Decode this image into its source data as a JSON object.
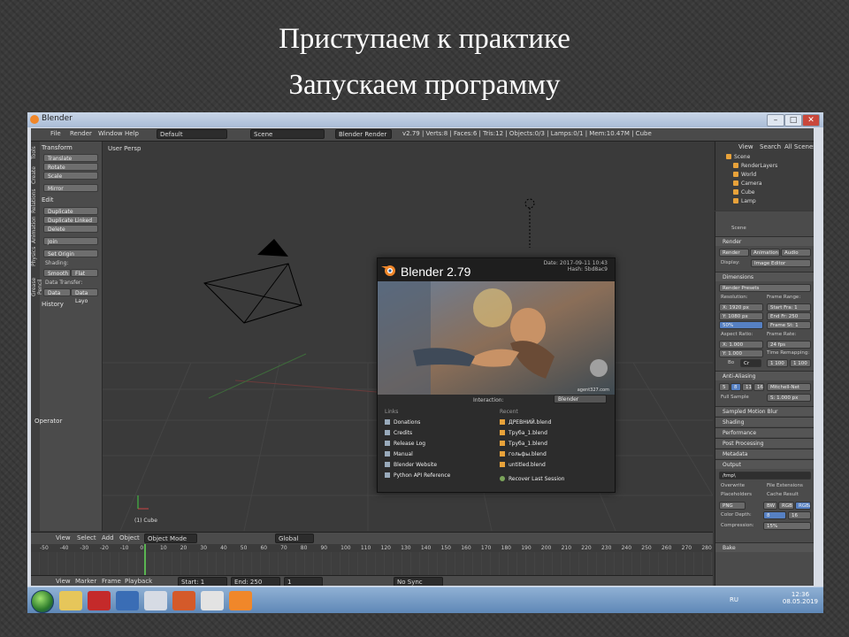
{
  "slide": {
    "title_line1": "Приступаем к практике",
    "title_line2": "Запускаем программу"
  },
  "window": {
    "title": "Blender",
    "buttons": [
      "–",
      "□",
      "✕"
    ]
  },
  "infobar": {
    "menus": [
      "File",
      "Render",
      "Window",
      "Help"
    ],
    "layout": "Default",
    "scene": "Scene",
    "engine": "Blender Render",
    "stats": "v2.79 | Verts:8 | Faces:6 | Tris:12 | Objects:0/3 | Lamps:0/1 | Mem:10.47M | Cube"
  },
  "toolshelf": {
    "tabs": [
      "Tools",
      "Create",
      "Relations",
      "Animation",
      "Physics",
      "Grease Pencil"
    ],
    "transform_header": "Transform",
    "transform_buttons": [
      "Translate",
      "Rotate",
      "Scale"
    ],
    "mirror": "Mirror",
    "edit_header": "Edit",
    "edit_buttons": [
      "Duplicate",
      "Duplicate Linked",
      "Delete"
    ],
    "join": "Join",
    "set_origin": "Set Origin",
    "shading_label": "Shading:",
    "smooth": "Smooth",
    "flat": "Flat",
    "data_transfer_label": "Data Transfer:",
    "data": "Data",
    "data_layout": "Data Layo",
    "history_header": "History",
    "operator_header": "Operator"
  },
  "viewport": {
    "label": "User Persp",
    "object_label": "(1) Cube",
    "header_menus": [
      "View",
      "Select",
      "Add",
      "Object"
    ],
    "mode": "Object Mode",
    "pivot": "Global"
  },
  "splash": {
    "title": "Blender 2.79",
    "date": "Date: 2017-09-11 10:43",
    "hash": "Hash: 5bd8ac9",
    "credit": "agent327.com",
    "interaction_label": "Interaction:",
    "interaction_value": "Blender",
    "links_header": "Links",
    "links": [
      "Donations",
      "Credits",
      "Release Log",
      "Manual",
      "Blender Website",
      "Python API Reference"
    ],
    "recent_header": "Recent",
    "recent": [
      "ДРЕВНИЙ.blend",
      "Труба_1.blend",
      "Труба_1.blend",
      "гольфы.blend",
      "untitled.blend"
    ],
    "recover": "Recover Last Session"
  },
  "timeline": {
    "ticks": [
      "-50",
      "-40",
      "-30",
      "-20",
      "-10",
      "0",
      "10",
      "20",
      "30",
      "40",
      "50",
      "60",
      "70",
      "80",
      "90",
      "100",
      "110",
      "120",
      "130",
      "140",
      "150",
      "160",
      "170",
      "180",
      "190",
      "200",
      "210",
      "220",
      "230",
      "240",
      "250",
      "260",
      "270",
      "280"
    ],
    "menus": [
      "View",
      "Marker",
      "Frame",
      "Playback"
    ],
    "start_label": "Start:",
    "start": "1",
    "end_label": "End:",
    "end": "250",
    "current": "1",
    "sync": "No Sync"
  },
  "outliner": {
    "menus": [
      "View",
      "Search",
      "All Scenes"
    ],
    "items": [
      "Scene",
      "RenderLayers",
      "World",
      "Camera",
      "Cube",
      "Lamp"
    ]
  },
  "properties": {
    "context": "Scene",
    "render_header": "Render",
    "render_buttons": [
      "Render",
      "Animation",
      "Audio"
    ],
    "display_label": "Display:",
    "display_value": "Image Editor",
    "dimensions_header": "Dimensions",
    "render_presets": "Render Presets",
    "resolution_label": "Resolution:",
    "res_x": "X: 1920 px",
    "res_y": "Y: 1080 px",
    "res_pct": "50%",
    "frame_range_label": "Frame Range:",
    "start_frame": "Start Fra: 1",
    "end_frame": "End Fr: 250",
    "frame_step": "Frame St: 1",
    "aspect_label": "Aspect Ratio:",
    "aspect_x": "X:   1.000",
    "aspect_y": "Y:   1.000",
    "frame_rate_label": "Frame Rate:",
    "frame_rate": "24 fps",
    "time_remap_label": "Time Remapping:",
    "bo": "Bo",
    "cr": "Cr",
    "remap_old": "1 100",
    "remap_new": "1 100",
    "anti_aliasing": "Anti-Aliasing",
    "aa_values": [
      "5",
      "8",
      "11",
      "16"
    ],
    "aa_filter": "Mitchell-Net",
    "full_sample": "Full Sample",
    "filter_size": "S: 1.000 px",
    "motion_blur": "Sampled Motion Blur",
    "panels": [
      "Shading",
      "Performance",
      "Post Processing",
      "Metadata",
      "Output"
    ],
    "output_path": "/tmp\\",
    "overwrite": "Overwrite",
    "file_ext": "File Extensions",
    "placeholders": "Placeholders",
    "cache_result": "Cache Result",
    "format": "PNG",
    "bw": "BW",
    "rgb": "RGB",
    "rgba": "RGBA",
    "color_depth_label": "Color Depth:",
    "depth8": "8",
    "depth16": "16",
    "compression_label": "Compression:",
    "compression": "15%",
    "bake_header": "Bake"
  },
  "taskbar": {
    "lang": "RU",
    "time": "12:36",
    "date": "08.05.2019"
  },
  "colors": {
    "accent_orange": "#e8a23a",
    "timeline_cursor": "#5ab552",
    "blender_bg": "#393939"
  }
}
